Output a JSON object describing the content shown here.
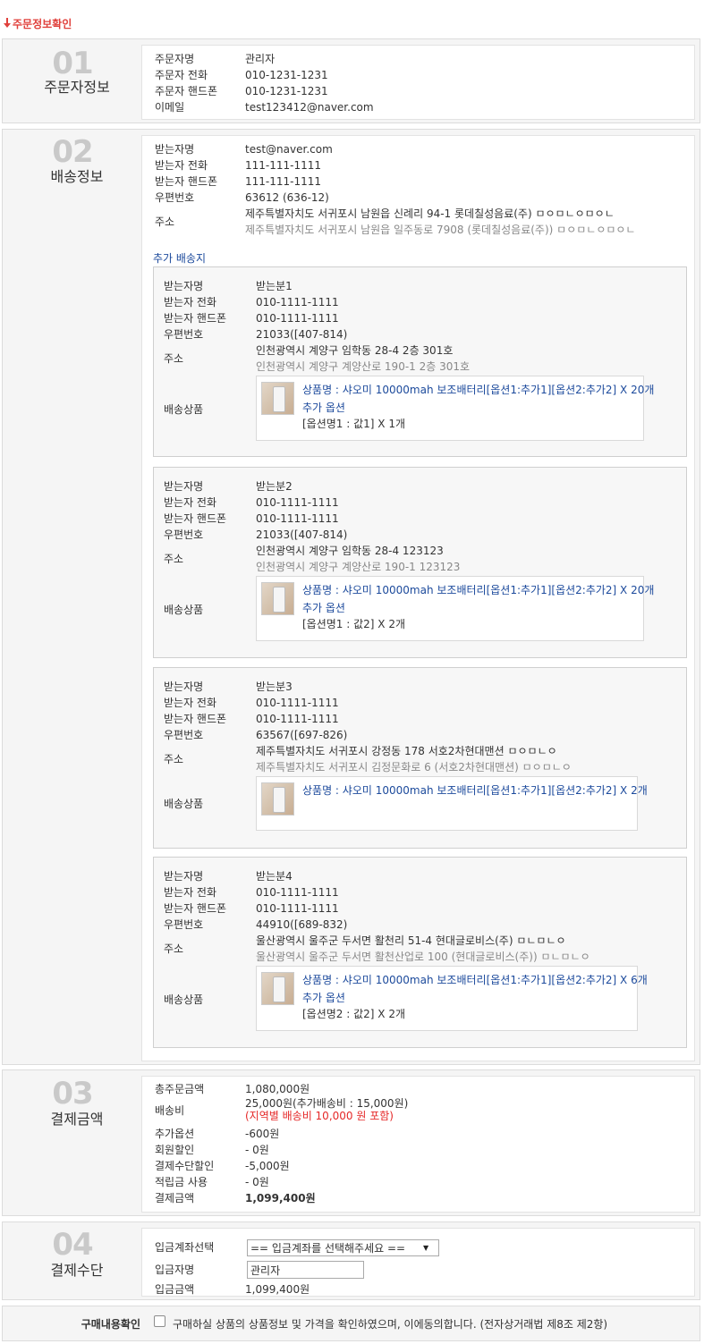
{
  "page_title": "주문정보확인",
  "orderer": {
    "num": "01",
    "label": "주문자정보",
    "rows": [
      {
        "label": "주문자명",
        "value": "관리자"
      },
      {
        "label": "주문자 전화",
        "value": "010-1231-1231"
      },
      {
        "label": "주문자 핸드폰",
        "value": "010-1231-1231"
      },
      {
        "label": "이메일",
        "value": "test123412@naver.com"
      }
    ]
  },
  "shipping": {
    "num": "02",
    "label": "배송정보",
    "rows": [
      {
        "label": "받는자명",
        "value": "test@naver.com"
      },
      {
        "label": "받는자 전화",
        "value": "111-111-1111"
      },
      {
        "label": "받는자 핸드폰",
        "value": "111-111-1111"
      },
      {
        "label": "우편번호",
        "value": "63612 (636-12)"
      }
    ],
    "address_label": "주소",
    "address_line1": "제주특별자치도 서귀포시 남원읍 신례리 94-1 롯데칠성음료(주) ㅁㅇㅁㄴㅇㅁㅇㄴ",
    "address_line2": "제주특별자치도 서귀포시 남원읍 일주동로 7908 (롯데칠성음료(주)) ㅁㅇㅁㄴㅇㅁㅇㄴ",
    "extra_title": "추가 배송지",
    "field_labels": {
      "name": "받는자명",
      "phone": "받는자 전화",
      "mobile": "받는자 핸드폰",
      "zip": "우편번호",
      "address": "주소",
      "products": "배송상품"
    },
    "extra": [
      {
        "name": "받는분1",
        "phone": "010-1111-1111",
        "mobile": "010-1111-1111",
        "zip": "21033([407-814)",
        "addr1": "인천광역시 계양구 임학동 28-4 2층 301호",
        "addr2": "인천광역시 계양구 계양산로 190-1 2층 301호",
        "product": "상품명 : 샤오미 10000mah 보조배터리[옵션1:추가1][옵션2:추가2] X 20개",
        "option_title": "추가 옵션",
        "option_value": "[옵션명1 : 값1] X 1개"
      },
      {
        "name": "받는분2",
        "phone": "010-1111-1111",
        "mobile": "010-1111-1111",
        "zip": "21033([407-814)",
        "addr1": "인천광역시 계양구 임학동 28-4 123123",
        "addr2": "인천광역시 계양구 계양산로 190-1 123123",
        "product": "상품명 : 샤오미 10000mah 보조배터리[옵션1:추가1][옵션2:추가2] X 20개",
        "option_title": "추가 옵션",
        "option_value": "[옵션명1 : 값2] X 2개"
      },
      {
        "name": "받는분3",
        "phone": "010-1111-1111",
        "mobile": "010-1111-1111",
        "zip": "63567([697-826)",
        "addr1": "제주특별자치도 서귀포시 강정동 178 서호2차현대맨션 ㅁㅇㅁㄴㅇ",
        "addr2": "제주특별자치도 서귀포시 김정문화로 6 (서호2차현대맨션) ㅁㅇㅁㄴㅇ",
        "product": "상품명 : 샤오미 10000mah 보조배터리[옵션1:추가1][옵션2:추가2] X 2개",
        "option_title": "",
        "option_value": ""
      },
      {
        "name": "받는분4",
        "phone": "010-1111-1111",
        "mobile": "010-1111-1111",
        "zip": "44910([689-832)",
        "addr1": "울산광역시 울주군 두서면 활천리 51-4 현대글로비스(주) ㅁㄴㅁㄴㅇ",
        "addr2": "울산광역시 울주군 두서면 활천산업로 100 (현대글로비스(주)) ㅁㄴㅁㄴㅇ",
        "product": "상품명 : 샤오미 10000mah 보조배터리[옵션1:추가1][옵션2:추가2] X 6개",
        "option_title": "추가 옵션",
        "option_value": "[옵션명2 : 값2] X 2개"
      }
    ]
  },
  "payment_amount": {
    "num": "03",
    "label": "결제금액",
    "total_label": "총주문금액",
    "total": "1,080,000원",
    "shipping_label": "배송비",
    "shipping": "25,000원(추가배송비 : 15,000원)",
    "shipping_note": "(지역별 배송비 10,000 원 포함)",
    "option_label": "추가옵션",
    "option": "-600원",
    "member_label": "회원할인",
    "member": "- 0원",
    "method_disc_label": "결제수단할인",
    "method_disc": "-5,000원",
    "points_label": "적립금 사용",
    "points": "- 0원",
    "final_label": "결제금액",
    "final": "1,099,400원"
  },
  "payment_method": {
    "num": "04",
    "label": "결제수단",
    "account_label": "입금계좌선택",
    "account_placeholder": "== 입금계좌를 선택해주세요 ==",
    "depositor_label": "입금자명",
    "depositor": "관리자",
    "amount_label": "입금금액",
    "amount": "1,099,400원"
  },
  "confirm": {
    "label": "구매내용확인",
    "text": "구매하실 상품의 상품정보 및 가격을 확인하였으며, 이에동의합니다. (전자상거래법 제8조 제2항)"
  },
  "colors": {
    "accent_red": "#e0403b",
    "link_blue": "#1c4a9c",
    "price_red": "#e52828"
  },
  "icons": [
    "arrow-down-icon",
    "chevron-down-icon",
    "product-thumbnail"
  ]
}
